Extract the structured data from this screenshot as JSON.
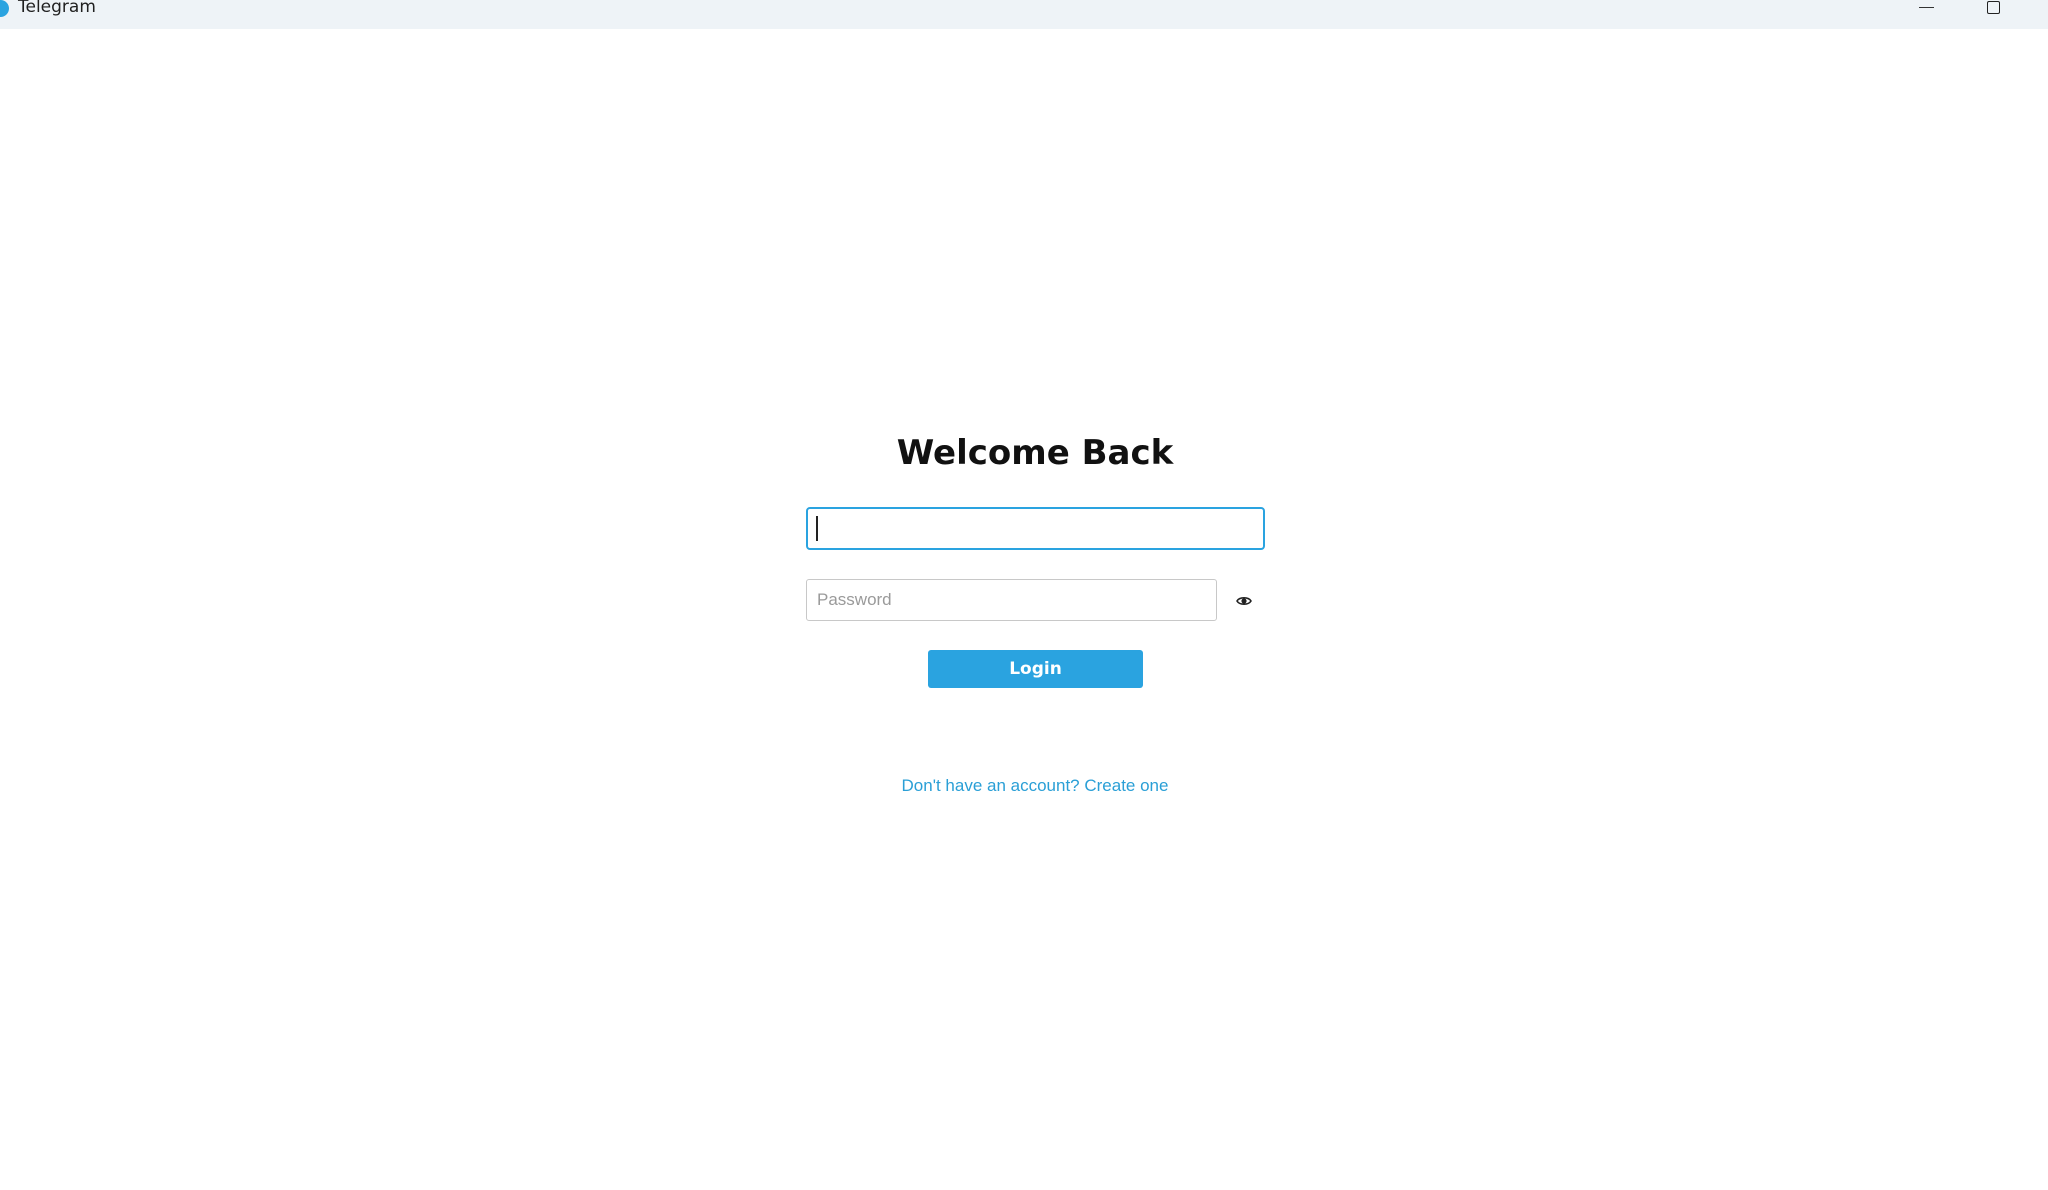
{
  "window": {
    "title": "Telegram",
    "app_icon": "telegram-icon",
    "controls": [
      "minimize-icon",
      "maximize-icon"
    ]
  },
  "login": {
    "heading": "Welcome Back",
    "username_value": "",
    "password_placeholder": "Password",
    "password_toggle_icon": "eye-icon",
    "login_label": "Login",
    "signup_link": "Don't have an account? Create one"
  },
  "colors": {
    "accent": "#2aa3e0",
    "link": "#2a9fd6",
    "titlebar_bg": "#eef3f7"
  }
}
